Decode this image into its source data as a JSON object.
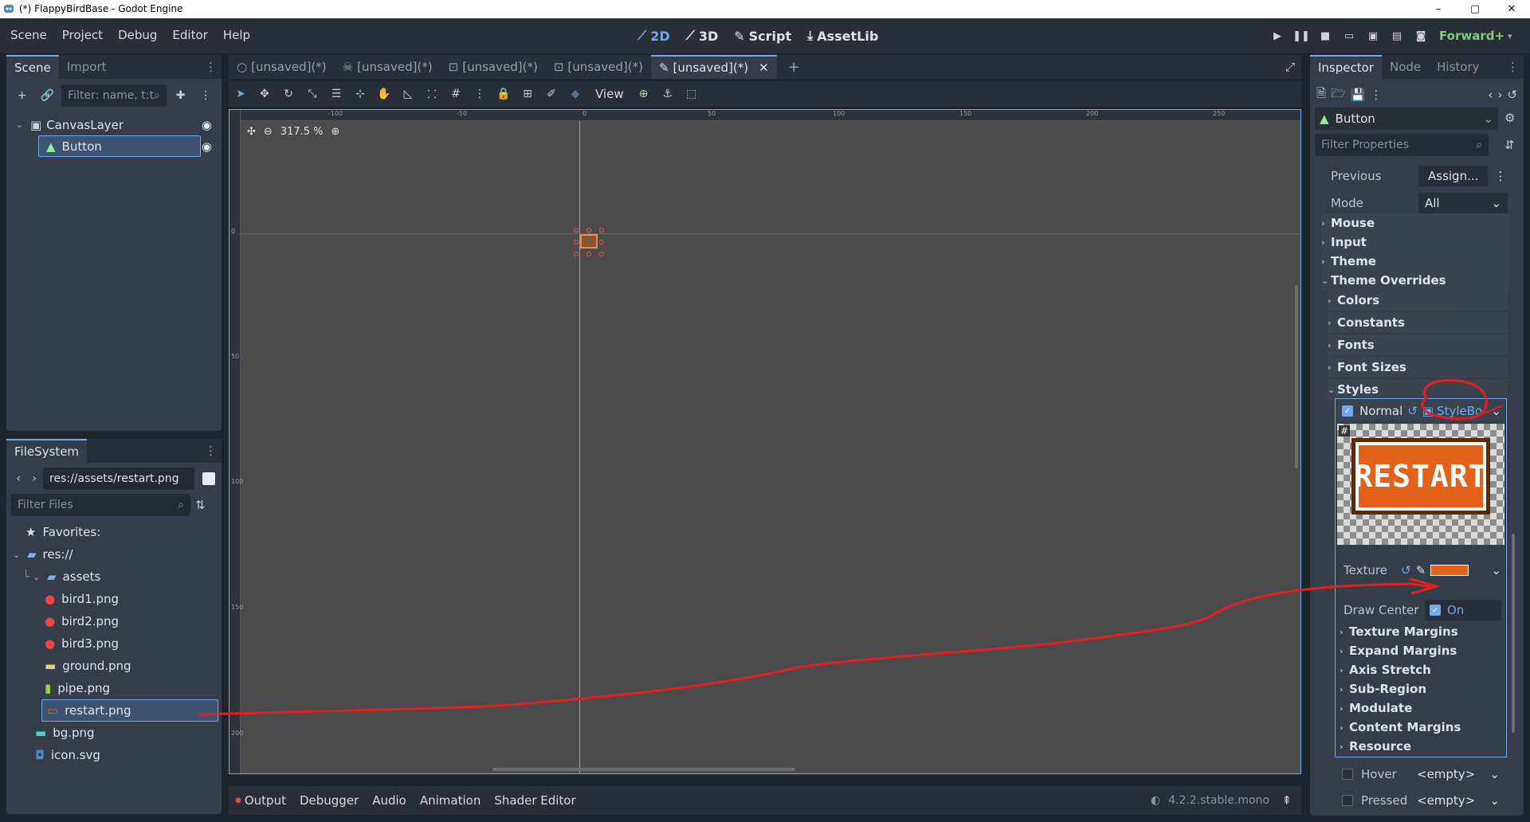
{
  "window": {
    "title": "(*) FlappyBirdBase - Godot Engine",
    "controls": [
      "–",
      "▢",
      "✕"
    ]
  },
  "menu": [
    "Scene",
    "Project",
    "Debug",
    "Editor",
    "Help"
  ],
  "workspaces": [
    {
      "label": "2D",
      "icon": "2d-icon",
      "active": true
    },
    {
      "label": "3D",
      "icon": "3d-icon",
      "active": false
    },
    {
      "label": "Script",
      "icon": "script-icon",
      "active": false
    },
    {
      "label": "AssetLib",
      "icon": "assetlib-icon",
      "active": false
    }
  ],
  "renderer": "Forward+",
  "scene_panel": {
    "tabs": [
      "Scene",
      "Import"
    ],
    "filter_placeholder": "Filter: name, t:t",
    "nodes": [
      {
        "label": "CanvasLayer",
        "icon": "canvas-layer-icon"
      },
      {
        "label": "Button",
        "icon": "button-node-icon",
        "selected": true
      }
    ]
  },
  "filesystem": {
    "tab": "FileSystem",
    "path": "res://assets/restart.png",
    "filter_placeholder": "Filter Files",
    "items": [
      {
        "label": "Favorites:",
        "icon": "star-icon"
      },
      {
        "label": "res://",
        "icon": "folder-icon"
      },
      {
        "label": "assets",
        "icon": "folder-icon"
      },
      {
        "label": "bird1.png",
        "icon": "bird-image-icon"
      },
      {
        "label": "bird2.png",
        "icon": "bird-image-icon"
      },
      {
        "label": "bird3.png",
        "icon": "bird-image-icon"
      },
      {
        "label": "ground.png",
        "icon": "ground-image-icon"
      },
      {
        "label": "pipe.png",
        "icon": "pipe-image-icon"
      },
      {
        "label": "restart.png",
        "icon": "restart-image-icon",
        "selected": true
      },
      {
        "label": "bg.png",
        "icon": "bg-image-icon"
      },
      {
        "label": "icon.svg",
        "icon": "godot-icon"
      }
    ]
  },
  "editor_tabs": [
    {
      "label": "[unsaved](*)",
      "icon": "node2d-icon"
    },
    {
      "label": "[unsaved](*)",
      "icon": "character-icon"
    },
    {
      "label": "[unsaved](*)",
      "icon": "area-icon"
    },
    {
      "label": "[unsaved](*)",
      "icon": "area-icon"
    },
    {
      "label": "[unsaved](*)",
      "icon": "control-icon",
      "active": true
    }
  ],
  "viewport": {
    "view_label": "View",
    "zoom": "317.5 %",
    "ruler_top": [
      "-100",
      "-50",
      "0",
      "50",
      "100",
      "150",
      "200",
      "250"
    ],
    "ruler_left": [
      "0",
      "50",
      "100",
      "150",
      "200"
    ]
  },
  "bottom_panel": {
    "tabs": [
      "Output",
      "Debugger",
      "Audio",
      "Animation",
      "Shader Editor"
    ],
    "version": "4.2.2.stable.mono"
  },
  "inspector": {
    "tabs": [
      "Inspector",
      "Node",
      "History"
    ],
    "node_name": "Button",
    "filter_placeholder": "Filter Properties",
    "previous_label": "Previous",
    "previous_value": "Assign...",
    "mode_label": "Mode",
    "mode_value": "All",
    "sections": [
      "Mouse",
      "Input",
      "Theme",
      "Theme Overrides"
    ],
    "override_subsections": [
      "Colors",
      "Constants",
      "Fonts",
      "Font Sizes",
      "Styles"
    ],
    "normal_label": "Normal",
    "normal_value": "StyleBo",
    "preview_text": "RESTART",
    "texture_label": "Texture",
    "draw_center_label": "Draw Center",
    "draw_center_value": "On",
    "stylebox_sections": [
      "Texture Margins",
      "Expand Margins",
      "Axis Stretch",
      "Sub-Region",
      "Modulate",
      "Content Margins",
      "Resource"
    ],
    "hover_label": "Hover",
    "hover_value": "<empty>",
    "pressed_label": "Pressed",
    "pressed_value": "<empty>"
  },
  "colors": {
    "accent": "#70a9ef",
    "annotation": "#e02020",
    "restart_orange": "#e2621c"
  }
}
